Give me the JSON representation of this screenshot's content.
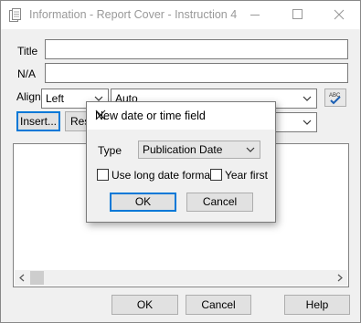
{
  "window": {
    "title": "Information - Report Cover - Instruction 4"
  },
  "form": {
    "title_label": "Title",
    "title_value": "",
    "na_label": "N/A",
    "na_value": "",
    "align_label": "Align",
    "align_value": "Left",
    "auto_value": "Auto",
    "insert_label": "Insert...",
    "reset_label_partial": "Res"
  },
  "buttons": {
    "ok": "OK",
    "cancel": "Cancel",
    "help": "Help"
  },
  "dialog": {
    "title": "New date or time field",
    "type_label": "Type",
    "type_value": "Publication Date",
    "long_date_label": "Use long date format",
    "long_date_checked": false,
    "year_first_label": "Year first",
    "year_first_checked": false,
    "ok": "OK",
    "cancel": "Cancel"
  }
}
